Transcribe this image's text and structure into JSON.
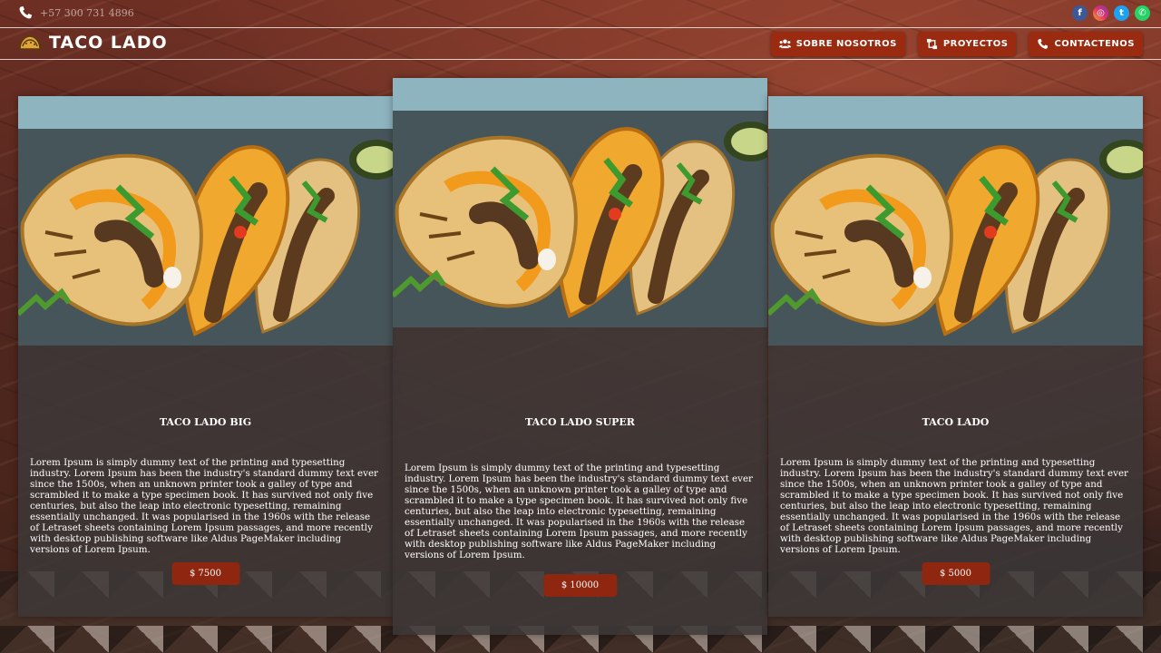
{
  "topbar": {
    "phone": "+57 300 731 4896",
    "social": [
      {
        "icon": "facebook-icon",
        "glyph": "f"
      },
      {
        "icon": "instagram-icon",
        "glyph": "◎"
      },
      {
        "icon": "twitter-icon",
        "glyph": "t"
      },
      {
        "icon": "whatsapp-icon",
        "glyph": "✆"
      }
    ]
  },
  "navbar": {
    "brand": "TACO LADO",
    "nav": [
      {
        "label": "SOBRE NOSOTROS",
        "icon": "users-icon"
      },
      {
        "label": "PROYECTOS",
        "icon": "sitemap-icon"
      },
      {
        "label": "CONTACTENOS",
        "icon": "phone-icon"
      }
    ]
  },
  "cards": [
    {
      "title": "TACO LADO BIG",
      "description": "Lorem Ipsum is simply dummy text of the printing and typesetting industry. Lorem Ipsum has been the industry's standard dummy text ever since the 1500s, when an unknown printer took a galley of type and scrambled it to make a type specimen book. It has survived not only five centuries, but also the leap into electronic typesetting, remaining essentially unchanged. It was popularised in the 1960s with the release of Letraset sheets containing Lorem Ipsum passages, and more recently with desktop publishing software like Aldus PageMaker including versions of Lorem Ipsum.",
      "price": "$ 7500"
    },
    {
      "title": "TACO LADO SUPER",
      "description": "Lorem Ipsum is simply dummy text of the printing and typesetting industry. Lorem Ipsum has been the industry's standard dummy text ever since the 1500s, when an unknown printer took a galley of type and scrambled it to make a type specimen book. It has survived not only five centuries, but also the leap into electronic typesetting, remaining essentially unchanged. It was popularised in the 1960s with the release of Letraset sheets containing Lorem Ipsum passages, and more recently with desktop publishing software like Aldus PageMaker including versions of Lorem Ipsum.",
      "price": "$ 10000"
    },
    {
      "title": "TACO LADO",
      "description": "Lorem Ipsum is simply dummy text of the printing and typesetting industry. Lorem Ipsum has been the industry's standard dummy text ever since the 1500s, when an unknown printer took a galley of type and scrambled it to make a type specimen book. It has survived not only five centuries, but also the leap into electronic typesetting, remaining essentially unchanged. It was popularised in the 1960s with the release of Letraset sheets containing Lorem Ipsum passages, and more recently with desktop publishing software like Aldus PageMaker including versions of Lorem Ipsum.",
      "price": "$ 5000"
    }
  ],
  "colors": {
    "accent": "#9a2a10",
    "card_bg": "#3c3838"
  }
}
